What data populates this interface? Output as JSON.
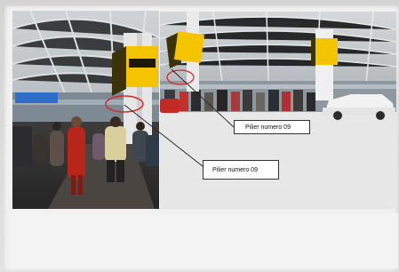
{
  "annotations": {
    "pillar_right_label": "Pilier numero 09",
    "pillar_left_label": "Pilier numero 09"
  },
  "photos": {
    "left": {
      "icon": "airport-terminal-photo"
    },
    "right": {
      "icon": "airport-terminal-photo"
    }
  },
  "colors": {
    "sign_yellow": "#f5c400",
    "highlight_red": "#d42a2a",
    "label_border": "#333333"
  }
}
